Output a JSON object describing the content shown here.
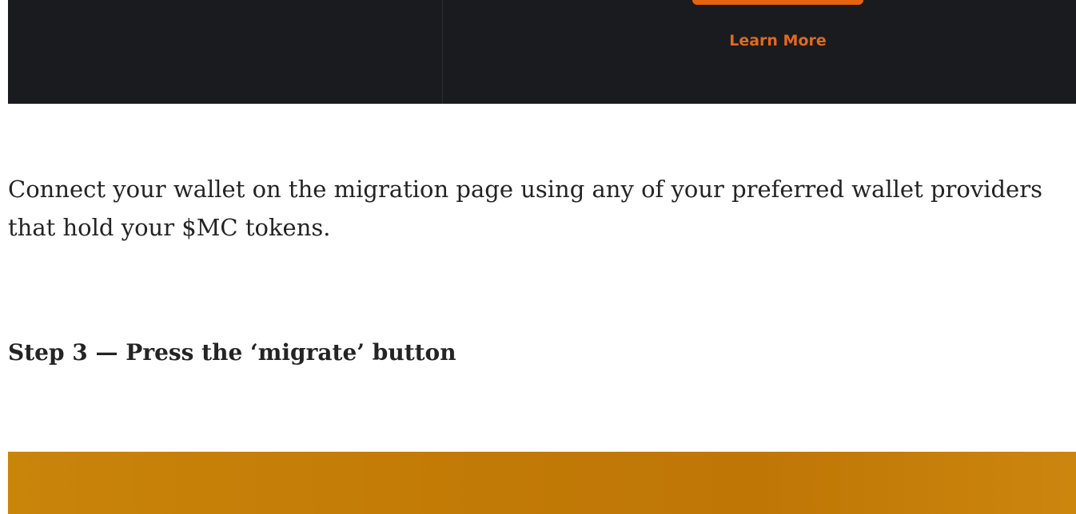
{
  "dark_panel": {
    "learn_more_label": "Learn More",
    "accent_color": "#e8630f",
    "background_color": "#1a1b1e"
  },
  "article": {
    "paragraph": "Connect your wallet on the migration page using any of your preferred wallet providers that hold your $MC tokens.",
    "step_heading": "Step 3 — Press the ‘migrate’ button"
  },
  "image_panel": {
    "color": "#c27a06"
  }
}
